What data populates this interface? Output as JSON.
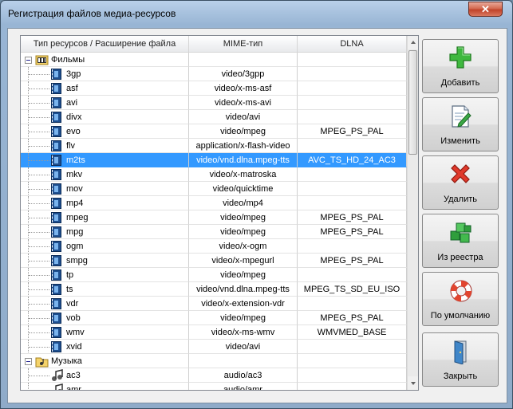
{
  "window": {
    "title": "Регистрация файлов медиа-ресурсов",
    "close_glyph": "✕"
  },
  "table": {
    "columns": [
      "Тип ресурсов / Расширение файла",
      "MIME-тип",
      "DLNA"
    ],
    "groups": [
      {
        "name": "Фильмы",
        "icon": "film-folder-icon"
      },
      {
        "name": "Музыка",
        "icon": "music-folder-icon"
      }
    ],
    "rows": [
      {
        "kind": "group",
        "label": "Фильмы",
        "mime": "",
        "dlna": ""
      },
      {
        "kind": "video",
        "label": "3gp",
        "mime": "video/3gpp",
        "dlna": ""
      },
      {
        "kind": "video",
        "label": "asf",
        "mime": "video/x-ms-asf",
        "dlna": ""
      },
      {
        "kind": "video",
        "label": "avi",
        "mime": "video/x-ms-avi",
        "dlna": ""
      },
      {
        "kind": "video",
        "label": "divx",
        "mime": "video/avi",
        "dlna": ""
      },
      {
        "kind": "video",
        "label": "evo",
        "mime": "video/mpeg",
        "dlna": "MPEG_PS_PAL"
      },
      {
        "kind": "video",
        "label": "flv",
        "mime": "application/x-flash-video",
        "dlna": ""
      },
      {
        "kind": "video",
        "label": "m2ts",
        "mime": "video/vnd.dlna.mpeg-tts",
        "dlna": "AVC_TS_HD_24_AC3",
        "selected": true
      },
      {
        "kind": "video",
        "label": "mkv",
        "mime": "video/x-matroska",
        "dlna": ""
      },
      {
        "kind": "video",
        "label": "mov",
        "mime": "video/quicktime",
        "dlna": ""
      },
      {
        "kind": "video",
        "label": "mp4",
        "mime": "video/mp4",
        "dlna": ""
      },
      {
        "kind": "video",
        "label": "mpeg",
        "mime": "video/mpeg",
        "dlna": "MPEG_PS_PAL"
      },
      {
        "kind": "video",
        "label": "mpg",
        "mime": "video/mpeg",
        "dlna": "MPEG_PS_PAL"
      },
      {
        "kind": "video",
        "label": "ogm",
        "mime": "video/x-ogm",
        "dlna": ""
      },
      {
        "kind": "video",
        "label": "smpg",
        "mime": "video/x-mpegurl",
        "dlna": "MPEG_PS_PAL"
      },
      {
        "kind": "video",
        "label": "tp",
        "mime": "video/mpeg",
        "dlna": ""
      },
      {
        "kind": "video",
        "label": "ts",
        "mime": "video/vnd.dlna.mpeg-tts",
        "dlna": "MPEG_TS_SD_EU_ISO"
      },
      {
        "kind": "video",
        "label": "vdr",
        "mime": "video/x-extension-vdr",
        "dlna": ""
      },
      {
        "kind": "video",
        "label": "vob",
        "mime": "video/mpeg",
        "dlna": "MPEG_PS_PAL"
      },
      {
        "kind": "video",
        "label": "wmv",
        "mime": "video/x-ms-wmv",
        "dlna": "WMVMED_BASE"
      },
      {
        "kind": "video",
        "label": "xvid",
        "mime": "video/avi",
        "dlna": ""
      },
      {
        "kind": "group",
        "label": "Музыка",
        "mime": "",
        "dlna": ""
      },
      {
        "kind": "audio",
        "label": "ac3",
        "mime": "audio/ac3",
        "dlna": ""
      },
      {
        "kind": "audio",
        "label": "amr",
        "mime": "audio/amr",
        "dlna": ""
      }
    ]
  },
  "buttons": [
    {
      "id": "add",
      "label": "Добавить",
      "icon": "plus-icon"
    },
    {
      "id": "edit",
      "label": "Изменить",
      "icon": "edit-document-icon"
    },
    {
      "id": "delete",
      "label": "Удалить",
      "icon": "delete-x-icon"
    },
    {
      "id": "registry",
      "label": "Из реестра",
      "icon": "registry-cubes-icon"
    },
    {
      "id": "default",
      "label": "По умолчанию",
      "icon": "lifebuoy-icon"
    },
    {
      "id": "close",
      "label": "Закрыть",
      "icon": "exit-door-icon"
    }
  ]
}
